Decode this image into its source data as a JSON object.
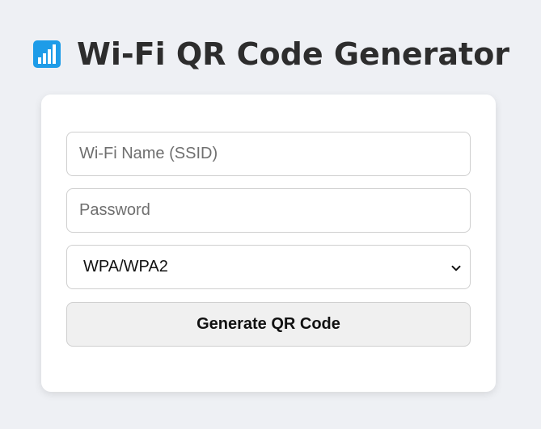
{
  "header": {
    "title": "Wi-Fi QR Code Generator",
    "icon": "signal-bars-icon",
    "icon_color": "#1e9ce8"
  },
  "form": {
    "ssid_placeholder": "Wi-Fi Name (SSID)",
    "ssid_value": "",
    "password_placeholder": "Password",
    "password_value": "",
    "security_selected": "WPA/WPA2",
    "generate_label": "Generate QR Code"
  }
}
